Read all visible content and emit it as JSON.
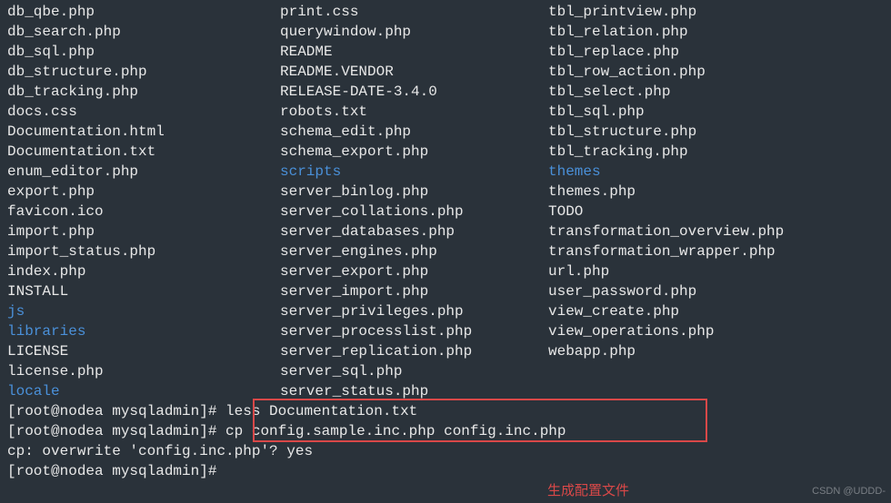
{
  "listing": {
    "col1": [
      {
        "name": "db_qbe.php",
        "type": "file"
      },
      {
        "name": "db_search.php",
        "type": "file"
      },
      {
        "name": "db_sql.php",
        "type": "file"
      },
      {
        "name": "db_structure.php",
        "type": "file"
      },
      {
        "name": "db_tracking.php",
        "type": "file"
      },
      {
        "name": "docs.css",
        "type": "file"
      },
      {
        "name": "Documentation.html",
        "type": "file"
      },
      {
        "name": "Documentation.txt",
        "type": "file"
      },
      {
        "name": "enum_editor.php",
        "type": "file"
      },
      {
        "name": "export.php",
        "type": "file"
      },
      {
        "name": "favicon.ico",
        "type": "file"
      },
      {
        "name": "import.php",
        "type": "file"
      },
      {
        "name": "import_status.php",
        "type": "file"
      },
      {
        "name": "index.php",
        "type": "file"
      },
      {
        "name": "INSTALL",
        "type": "file"
      },
      {
        "name": "js",
        "type": "dir"
      },
      {
        "name": "libraries",
        "type": "dir"
      },
      {
        "name": "LICENSE",
        "type": "file"
      },
      {
        "name": "license.php",
        "type": "file"
      },
      {
        "name": "locale",
        "type": "dir"
      }
    ],
    "col2": [
      {
        "name": "print.css",
        "type": "file"
      },
      {
        "name": "querywindow.php",
        "type": "file"
      },
      {
        "name": "README",
        "type": "file"
      },
      {
        "name": "README.VENDOR",
        "type": "file"
      },
      {
        "name": "RELEASE-DATE-3.4.0",
        "type": "file"
      },
      {
        "name": "robots.txt",
        "type": "file"
      },
      {
        "name": "schema_edit.php",
        "type": "file"
      },
      {
        "name": "schema_export.php",
        "type": "file"
      },
      {
        "name": "scripts",
        "type": "dir"
      },
      {
        "name": "server_binlog.php",
        "type": "file"
      },
      {
        "name": "server_collations.php",
        "type": "file"
      },
      {
        "name": "server_databases.php",
        "type": "file"
      },
      {
        "name": "server_engines.php",
        "type": "file"
      },
      {
        "name": "server_export.php",
        "type": "file"
      },
      {
        "name": "server_import.php",
        "type": "file"
      },
      {
        "name": "server_privileges.php",
        "type": "file"
      },
      {
        "name": "server_processlist.php",
        "type": "file"
      },
      {
        "name": "server_replication.php",
        "type": "file"
      },
      {
        "name": "server_sql.php",
        "type": "file"
      },
      {
        "name": "server_status.php",
        "type": "file"
      }
    ],
    "col3": [
      {
        "name": "tbl_printview.php",
        "type": "file"
      },
      {
        "name": "tbl_relation.php",
        "type": "file"
      },
      {
        "name": "tbl_replace.php",
        "type": "file"
      },
      {
        "name": "tbl_row_action.php",
        "type": "file"
      },
      {
        "name": "tbl_select.php",
        "type": "file"
      },
      {
        "name": "tbl_sql.php",
        "type": "file"
      },
      {
        "name": "tbl_structure.php",
        "type": "file"
      },
      {
        "name": "tbl_tracking.php",
        "type": "file"
      },
      {
        "name": "themes",
        "type": "dir"
      },
      {
        "name": "themes.php",
        "type": "file"
      },
      {
        "name": "TODO",
        "type": "file"
      },
      {
        "name": "transformation_overview.php",
        "type": "file"
      },
      {
        "name": "transformation_wrapper.php",
        "type": "file"
      },
      {
        "name": "url.php",
        "type": "file"
      },
      {
        "name": "user_password.php",
        "type": "file"
      },
      {
        "name": "view_create.php",
        "type": "file"
      },
      {
        "name": "view_operations.php",
        "type": "file"
      },
      {
        "name": "webapp.php",
        "type": "file"
      }
    ]
  },
  "prompts": {
    "p1_prompt": "[root@nodea mysqladmin]# ",
    "p1_cmd": "less Documentation.txt",
    "p2_prompt": "[root@nodea mysqladmin]# ",
    "p2_cmd": "cp config.sample.inc.php config.inc.php",
    "p3_text": "cp: overwrite 'config.inc.php'? yes",
    "p4_prompt": "[root@nodea mysqladmin]# "
  },
  "annotation": "生成配置文件",
  "watermark": "CSDN @UDDD-",
  "colors": {
    "bg": "#2a323a",
    "fg": "#e8e8e8",
    "dir": "#4a90d9",
    "highlight": "#d94848"
  }
}
